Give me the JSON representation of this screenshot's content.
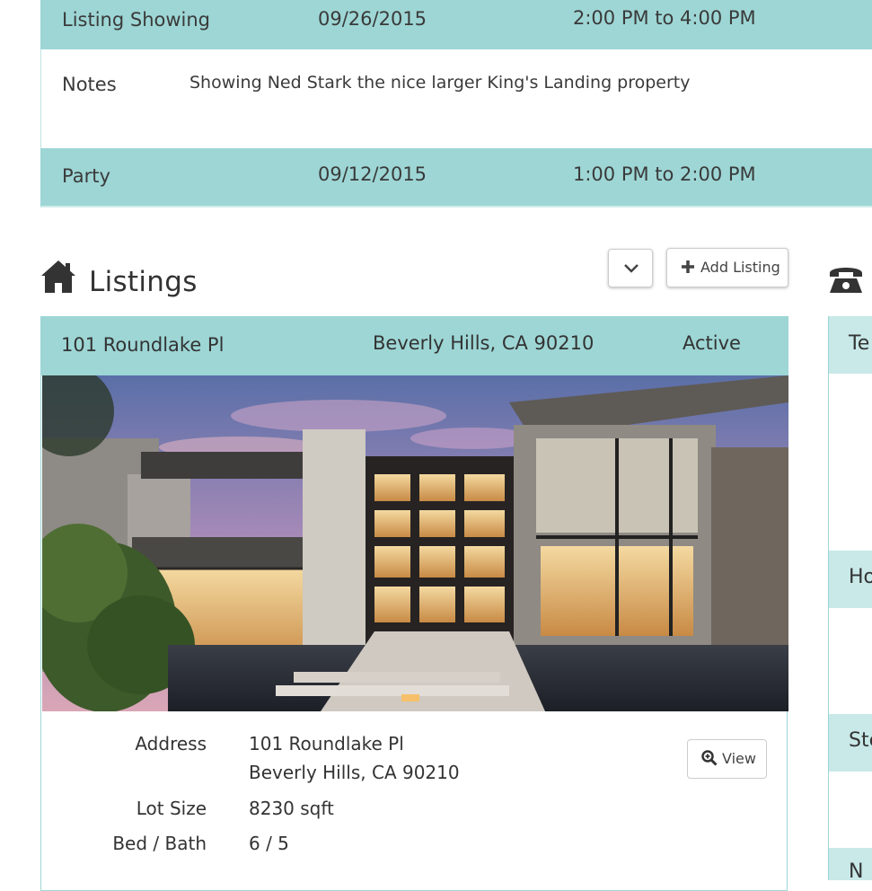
{
  "events": [
    {
      "type": "Listing Showing",
      "date": "09/26/2015",
      "time": "2:00 PM to 4:00 PM",
      "notes_label": "Notes",
      "notes": "Showing Ned Stark the nice larger King's Landing property"
    },
    {
      "type": "Party",
      "date": "09/12/2015",
      "time": "1:00 PM to 2:00 PM"
    }
  ],
  "listings": {
    "title": "Listings",
    "add_label": "Add Listing",
    "card": {
      "street": "101 Roundlake Pl",
      "city": "Beverly Hills, CA 90210",
      "status": "Active",
      "details": {
        "address_label": "Address",
        "address_line1": "101 Roundlake Pl",
        "address_line2": "Beverly Hills, CA 90210",
        "lot_label": "Lot Size",
        "lot_value": "8230 sqft",
        "bedbath_label": "Bed / Bath",
        "bedbath_value": "6 / 5"
      },
      "view_label": "View"
    }
  },
  "right_panel": {
    "rows": [
      "Te",
      "Ho",
      "Ste",
      "N"
    ]
  },
  "colors": {
    "accent": "#9dd6d5",
    "text": "#333333"
  },
  "icons": [
    "house-icon",
    "chevron-down-icon",
    "plus-icon",
    "zoom-in-icon",
    "phone-icon"
  ]
}
